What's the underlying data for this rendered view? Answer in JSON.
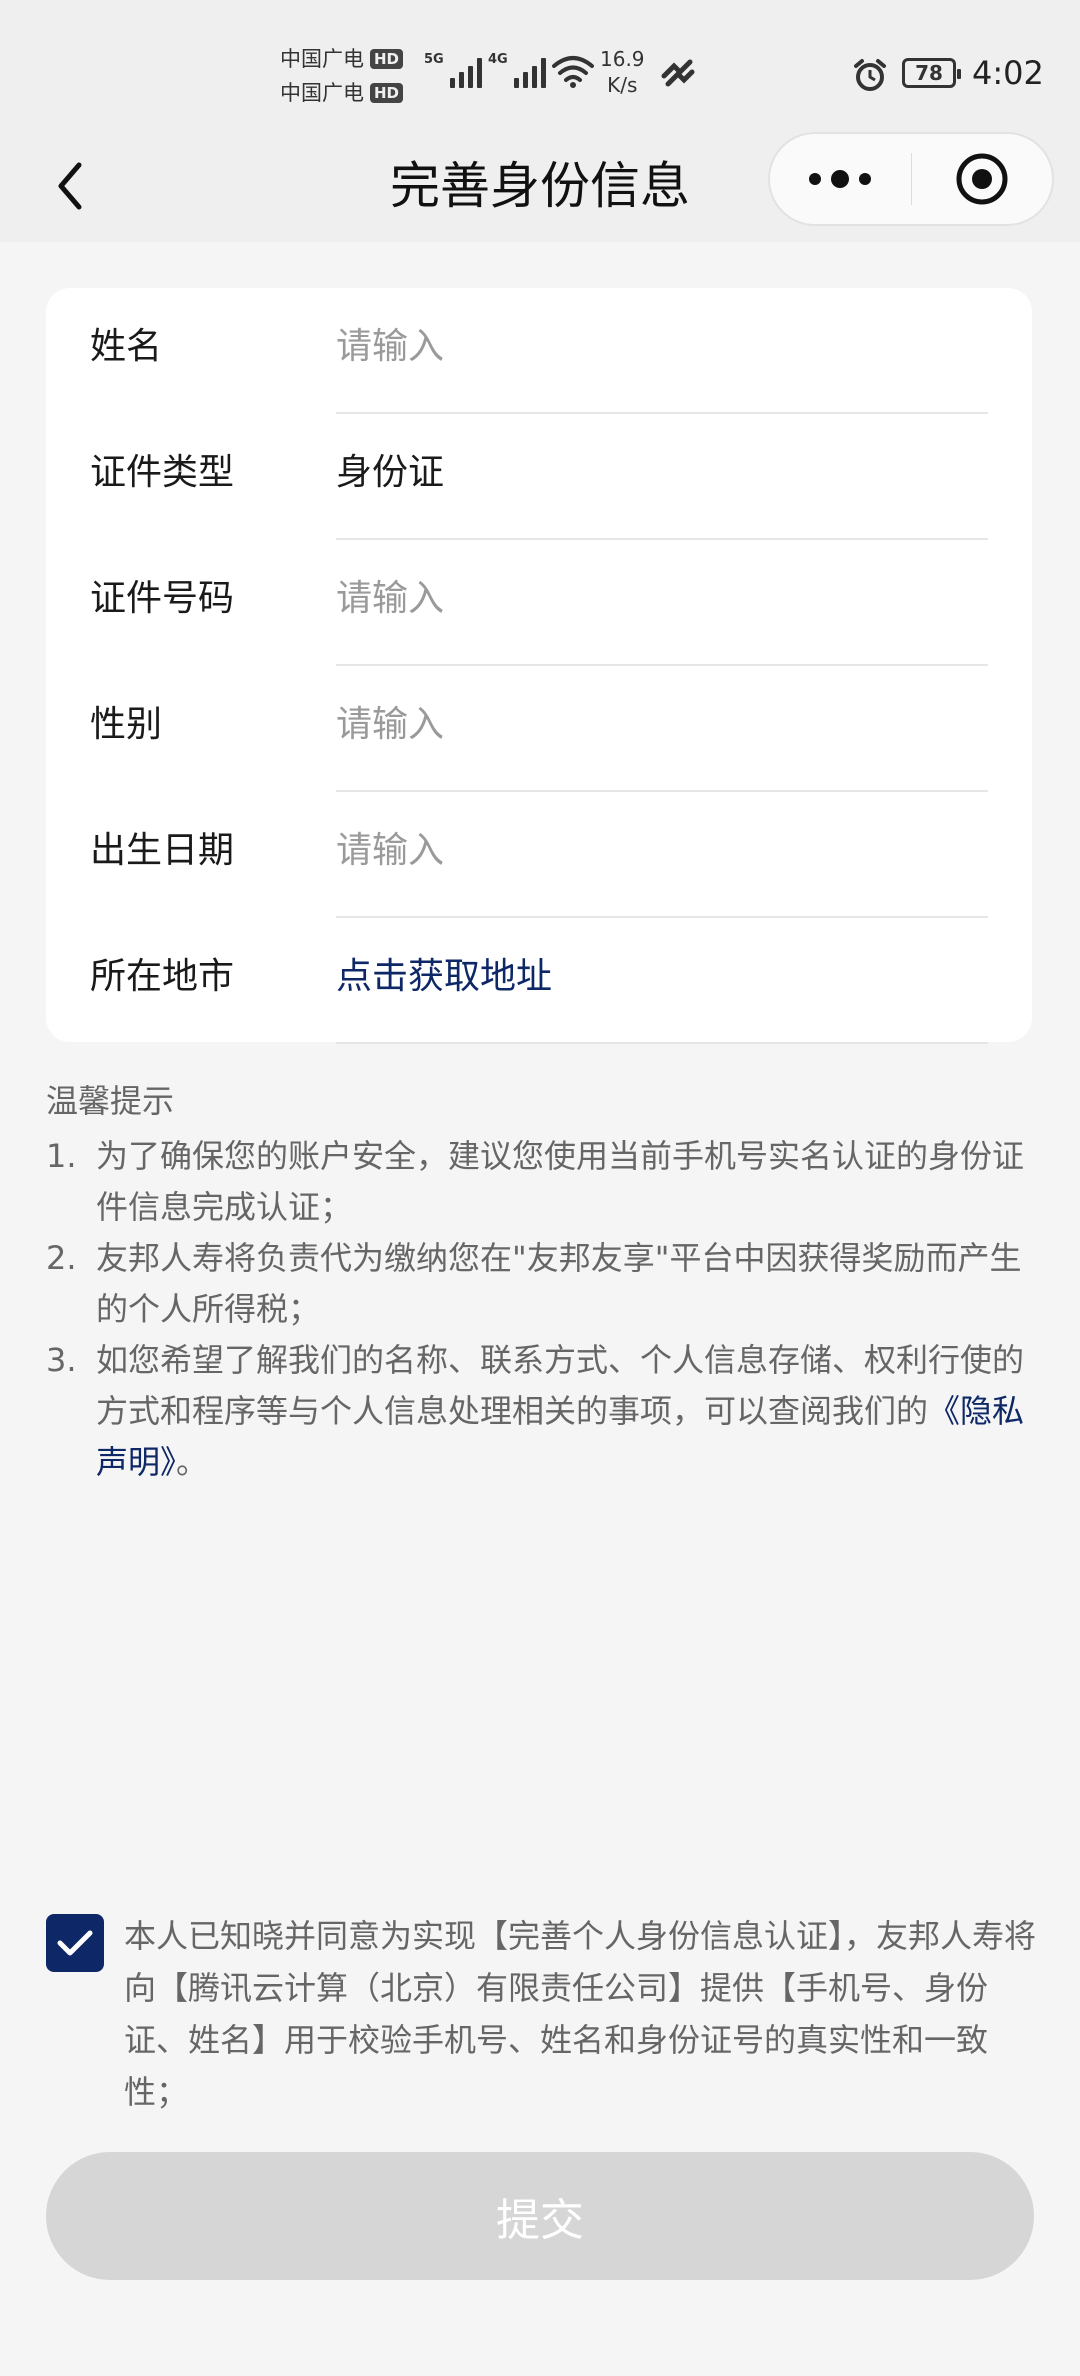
{
  "status_bar": {
    "carrier_1": "中国广电",
    "carrier_2": "中国广电",
    "hd_badge": "HD",
    "net_5g": "5G",
    "net_4g": "4G",
    "speed_value": "16.9",
    "speed_unit": "K/s",
    "battery": "78",
    "time": "4:02"
  },
  "nav": {
    "title": "完善身份信息"
  },
  "form": {
    "fields": [
      {
        "label": "姓名",
        "placeholder": "请输入"
      },
      {
        "label": "证件类型",
        "value": "身份证"
      },
      {
        "label": "证件号码",
        "placeholder": "请输入"
      },
      {
        "label": "性别",
        "placeholder": "请输入"
      },
      {
        "label": "出生日期",
        "placeholder": "请输入"
      },
      {
        "label": "所在地市",
        "link": "点击获取地址"
      }
    ]
  },
  "tips": {
    "heading": "温馨提示",
    "items": [
      {
        "num": "1.",
        "text": "为了确保您的账户安全，建议您使用当前手机号实名认证的身份证件信息完成认证；"
      },
      {
        "num": "2.",
        "text": "友邦人寿将负责代为缴纳您在\"友邦友享\"平台中因获得奖励而产生的个人所得税；"
      },
      {
        "num": "3.",
        "text": "如您希望了解我们的名称、联系方式、个人信息存储、权利行使的方式和程序等与个人信息处理相关的事项，可以查阅我们的",
        "link": "《隐私声明》",
        "suffix": "。"
      }
    ]
  },
  "agreement": {
    "checked": true,
    "text": "本人已知晓并同意为实现【完善个人身份信息认证】，友邦人寿将向【腾讯云计算（北京）有限责任公司】提供【手机号、身份证、姓名】用于校验手机号、姓名和身份证号的真实性和一致性；"
  },
  "submit": {
    "label": "提交"
  },
  "colors": {
    "brand": "#0e2766",
    "disabled_button": "#d6d6d6",
    "background": "#f5f5f5"
  }
}
